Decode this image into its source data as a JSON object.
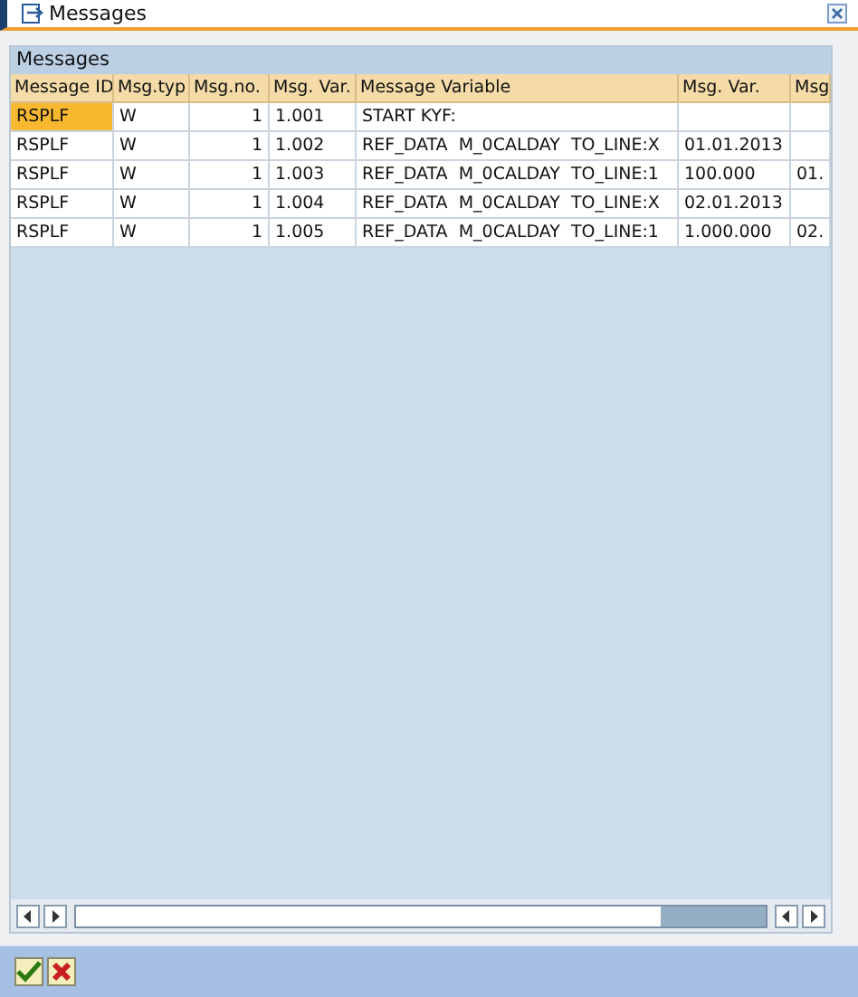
{
  "window": {
    "title": "Messages"
  },
  "table": {
    "title": "Messages",
    "columns": [
      "Message ID",
      "Msg.typ",
      "Msg.no.",
      "Msg. Var.",
      "Message Variable",
      "Msg. Var.",
      "Msg"
    ],
    "rows": [
      {
        "selected": true,
        "cells": [
          "RSPLF",
          "W",
          "1",
          "1.001",
          "START KYF:",
          "",
          ""
        ]
      },
      {
        "selected": false,
        "cells": [
          "RSPLF",
          "W",
          "1",
          "1.002",
          "REF_DATA  M_0CALDAY  TO_LINE:X",
          "01.01.2013",
          ""
        ]
      },
      {
        "selected": false,
        "cells": [
          "RSPLF",
          "W",
          "1",
          "1.003",
          "REF_DATA  M_0CALDAY  TO_LINE:1",
          "100.000",
          "01."
        ]
      },
      {
        "selected": false,
        "cells": [
          "RSPLF",
          "W",
          "1",
          "1.004",
          "REF_DATA  M_0CALDAY  TO_LINE:X",
          "02.01.2013",
          ""
        ]
      },
      {
        "selected": false,
        "cells": [
          "RSPLF",
          "W",
          "1",
          "1.005",
          "REF_DATA  M_0CALDAY  TO_LINE:1",
          "1.000.000",
          "02."
        ]
      }
    ]
  }
}
